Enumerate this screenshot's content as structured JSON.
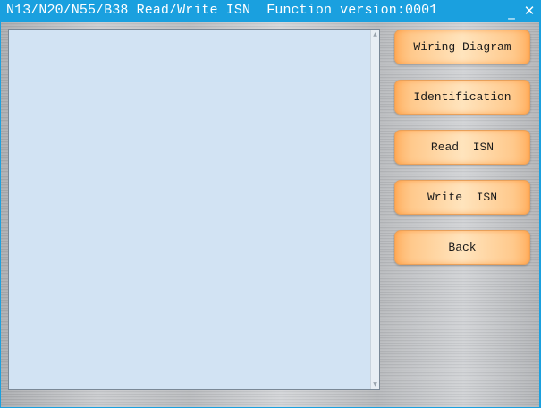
{
  "window": {
    "title": "N13/N20/N55/B38 Read/Write ISN  Function version:0001",
    "minimize_glyph": "_",
    "close_glyph": "✕"
  },
  "output": {
    "text": "",
    "scroll_up_glyph": "▲",
    "scroll_down_glyph": "▼"
  },
  "buttons": {
    "wiring_diagram": "Wiring Diagram",
    "identification": "Identification",
    "read_isn": "Read  ISN",
    "write_isn": "Write  ISN",
    "back": "Back"
  },
  "colors": {
    "titlebar": "#1aa0df",
    "textbox_bg": "#d2e3f3",
    "button_orange": "#ffb264",
    "button_light": "#ffe4bd"
  }
}
